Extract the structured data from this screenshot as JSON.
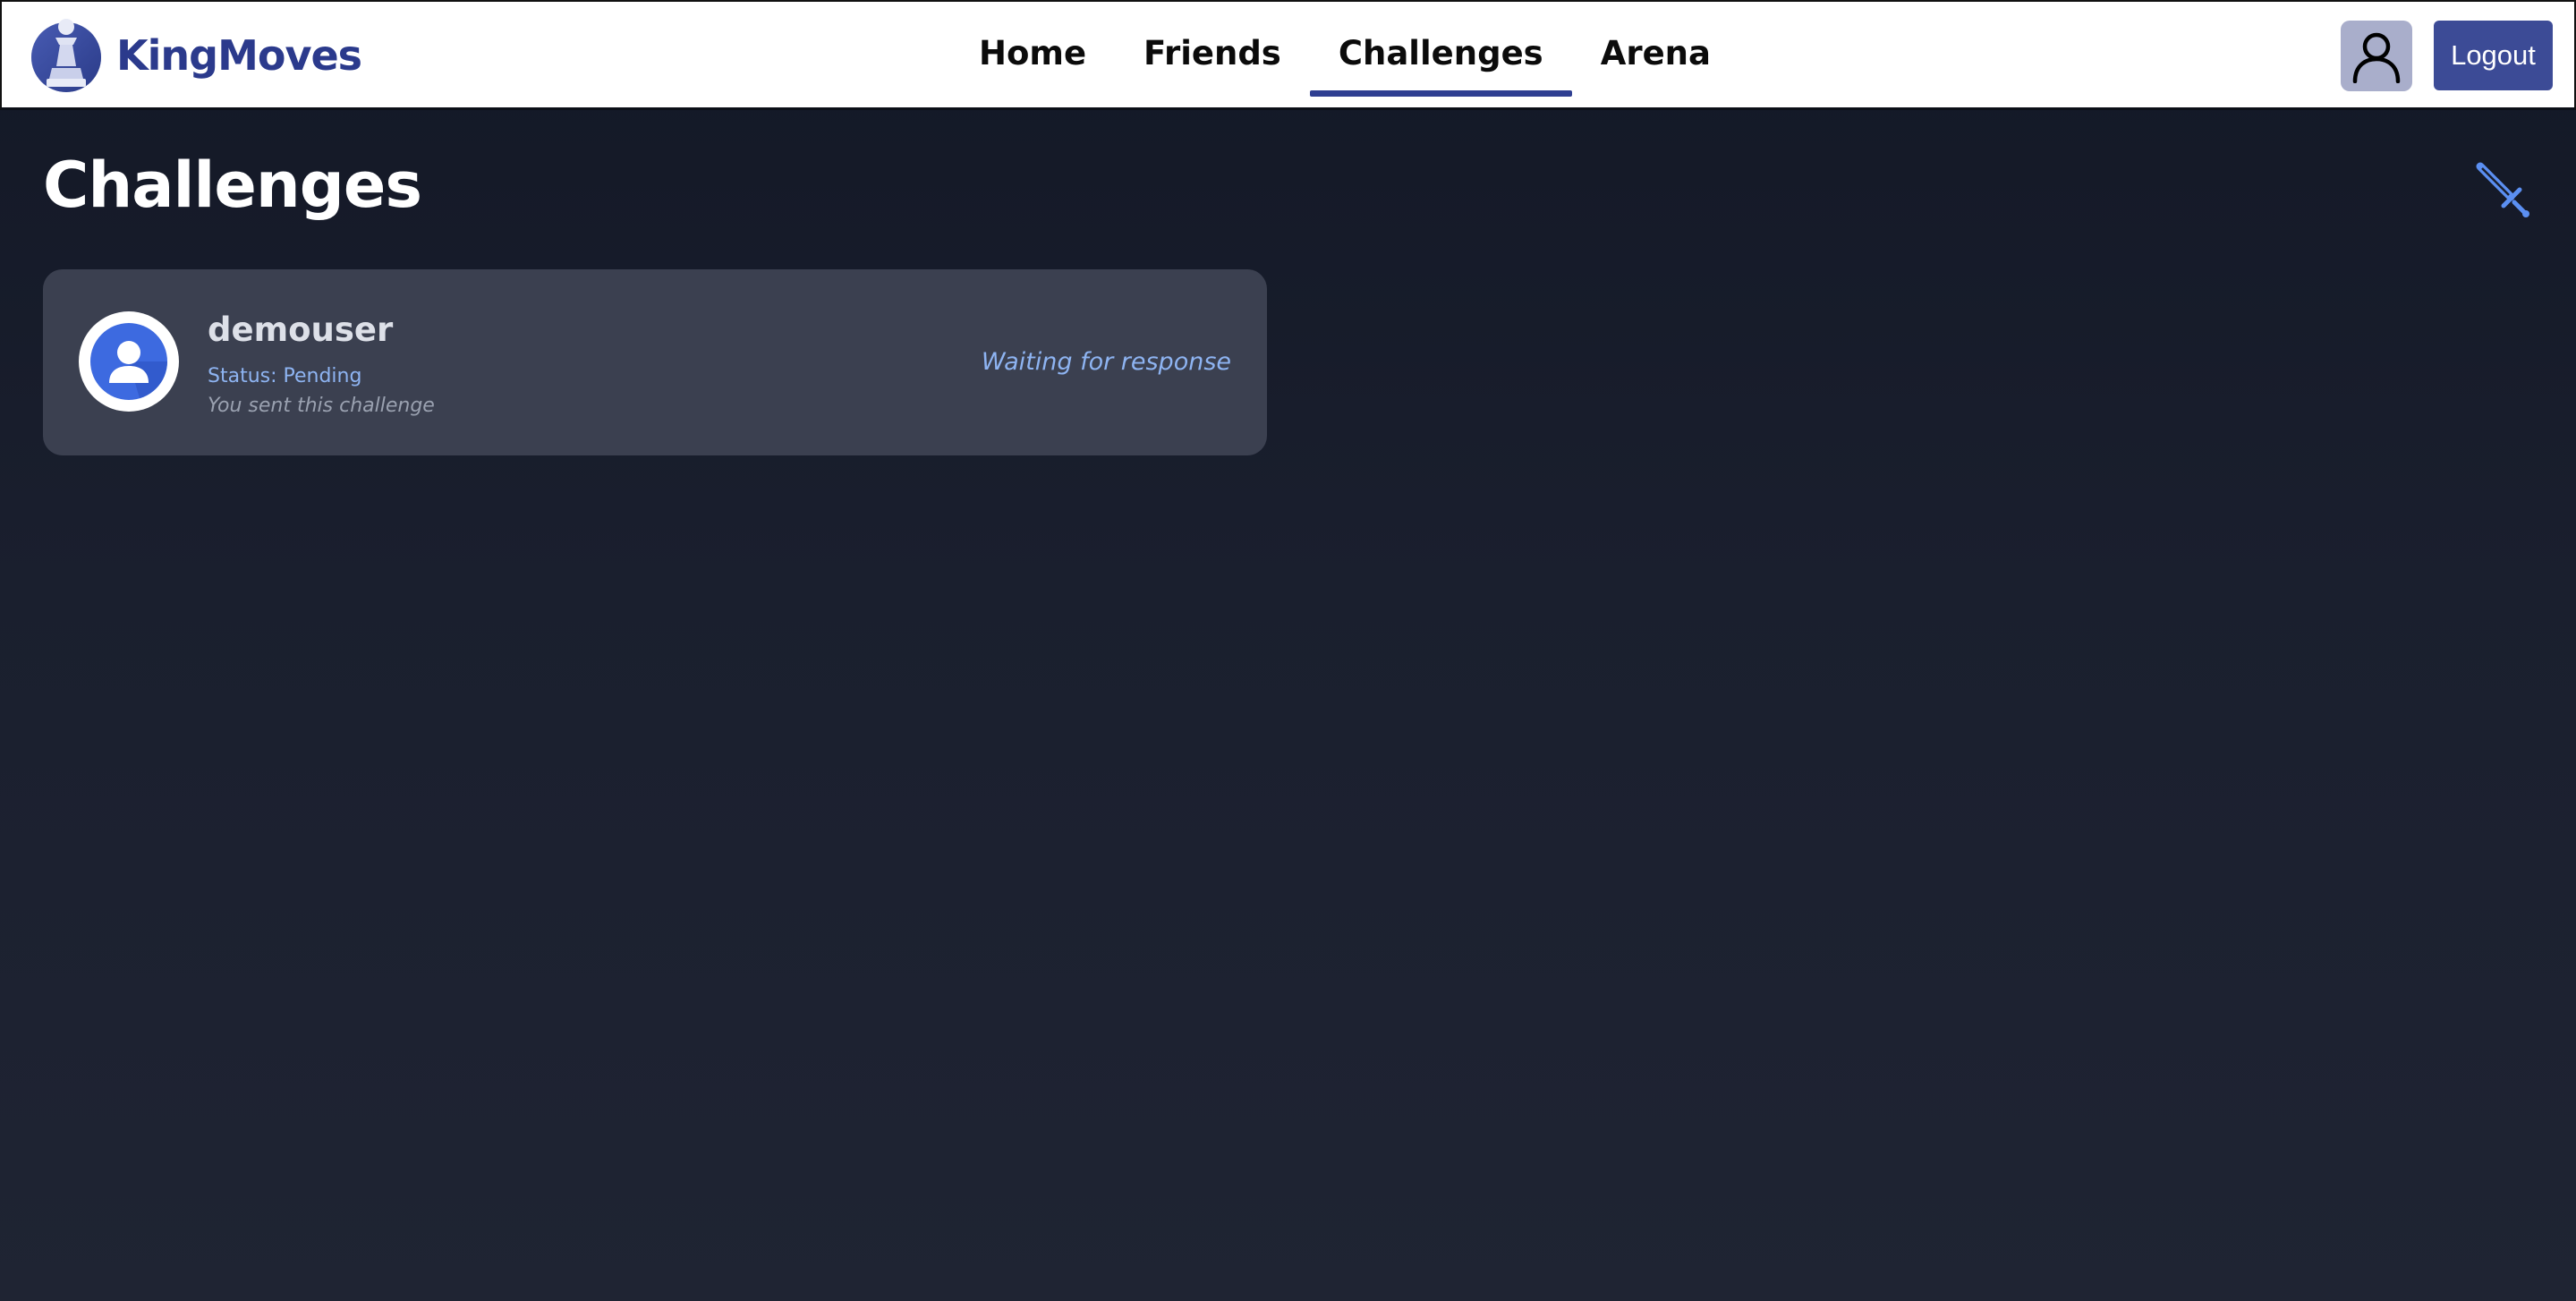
{
  "app": {
    "brand_name": "KingMoves"
  },
  "nav": {
    "items": [
      {
        "label": "Home",
        "active": false
      },
      {
        "label": "Friends",
        "active": false
      },
      {
        "label": "Challenges",
        "active": true
      },
      {
        "label": "Arena",
        "active": false
      }
    ],
    "logout_label": "Logout"
  },
  "main": {
    "title": "Challenges"
  },
  "challenges": [
    {
      "username": "demouser",
      "status": "Status: Pending",
      "note": "You sent this challenge",
      "action_text": "Waiting for response"
    }
  ],
  "icons": {
    "brand": "chess-pawn-icon",
    "profile": "user-outline-icon",
    "new_challenge": "sword-icon",
    "card_avatar": "user-avatar-icon"
  },
  "colors": {
    "brand": "#2b3a8c",
    "nav_active_underline": "#2f3f92",
    "logout_bg": "#3c4b96",
    "profile_btn_bg": "#a9aecb",
    "page_bg_top": "#131826",
    "page_bg_bottom": "#1f2433",
    "card_bg": "#3b4050",
    "status_accent": "#8eb4f2",
    "avatar_blue": "#3d6ae0"
  }
}
